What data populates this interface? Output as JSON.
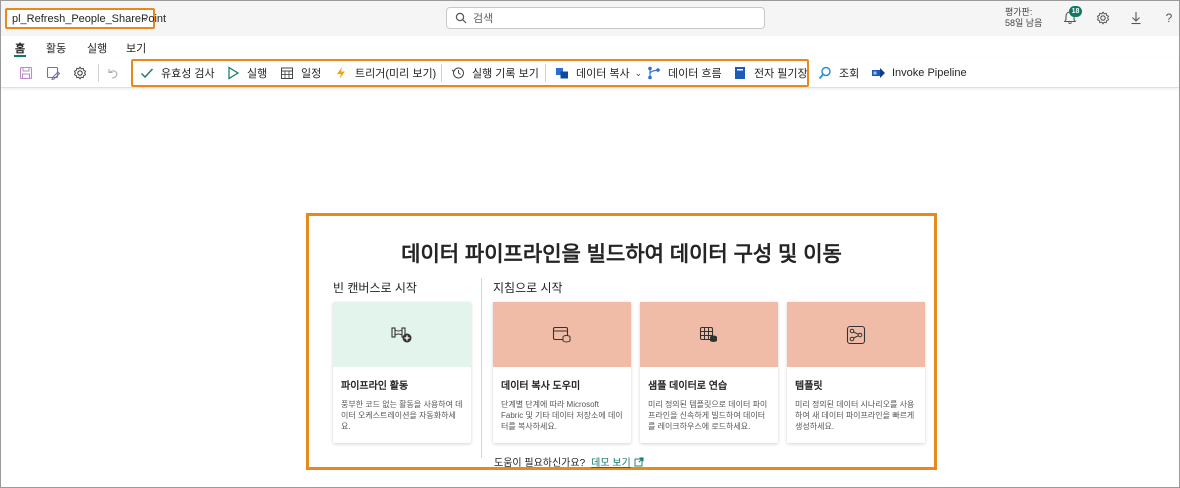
{
  "header": {
    "pipeline_name": "pl_Refresh_People_SharePoint",
    "search_placeholder": "검색",
    "trial_line1": "평가판:",
    "trial_line2": "58일 남음",
    "notification_count": "18"
  },
  "tabs": [
    {
      "label": "홈"
    },
    {
      "label": "활동"
    },
    {
      "label": "실행"
    },
    {
      "label": "보기"
    }
  ],
  "toolbar": {
    "validate": "유효성 검사",
    "run": "실행",
    "schedule": "일정",
    "trigger": "트리거(미리 보기)",
    "run_history": "실행 기록 보기",
    "copy_data": "데이터 복사",
    "dataflow": "데이터 흐름",
    "notebook": "전자 필기장",
    "lookup": "조회",
    "invoke_pipeline": "Invoke Pipeline"
  },
  "main": {
    "headline": "데이터 파이프라인을 빌드하여 데이터 구성 및 이동",
    "blank_section": "빈 캔버스로 시작",
    "guided_section": "지침으로 시작",
    "cards": [
      {
        "title": "파이프라인 활동",
        "desc": "풍부한 코드 없는 활동을 사용하여 데이터 오케스트레이션을 자동화하세요.",
        "icon": "pipeline-activity-icon"
      },
      {
        "title": "데이터 복사 도우미",
        "desc": "단계별 단계에 따라 Microsoft Fabric 및 기타 데이터 저장소에 데이터를 복사하세요.",
        "icon": "copy-assistant-icon"
      },
      {
        "title": "샘플 데이터로 연습",
        "desc": "미리 정의된 템플릿으로 데이터 파이프라인을 신속하게 빌드하여 데이터를 레이크하우스에 로드하세요.",
        "icon": "sample-data-icon"
      },
      {
        "title": "템플릿",
        "desc": "미리 정의된 데이터 시나리오를 사용하여 새 데이터 파이프라인을 빠르게 생성하세요.",
        "icon": "template-icon"
      }
    ],
    "help_text": "도움이 필요하신가요?",
    "demo_link": "데모 보기"
  },
  "colors": {
    "accent": "#117865",
    "highlight": "#e8891c",
    "blank_card_banner": "#e3f4ec",
    "guided_card_banner": "#f1bca7"
  }
}
